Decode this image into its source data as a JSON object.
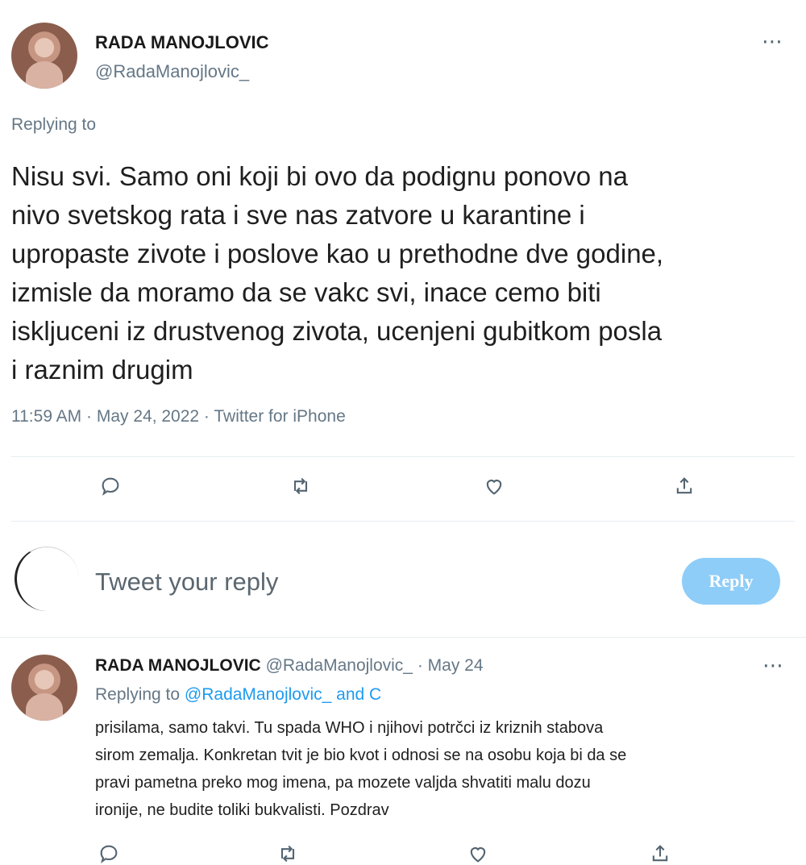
{
  "tweet": {
    "author_name": "RADA MANOJLOVIC",
    "author_handle": "@RadaManojlovic_",
    "replying_to_label": "Replying to",
    "text_lines": [
      "Nisu svi. Samo oni koji bi ovo da podignu ponovo na",
      "nivo svetskog rata i sve nas zatvore u karantine i",
      "upropaste zivote i poslove kao u prethodne dve godine,",
      "izmisle da moramo da se vakc svi, inace cemo biti",
      "iskljuceni iz drustvenog zivota, ucenjeni gubitkom posla",
      "i raznim drugim"
    ],
    "meta": "11:59 AM · May 24, 2022 · Twitter for iPhone",
    "more_icon": "⋯",
    "actions": [
      "reply-icon",
      "retweet-icon",
      "like-icon",
      "share-icon"
    ]
  },
  "reply_box": {
    "placeholder": "Tweet your reply",
    "button_label": "Reply",
    "button_color": "#8ecdf8"
  },
  "reply_tweet": {
    "author_name": "RADA MANOJLOVIC",
    "author_handle": "@RadaManojlovic_",
    "date": "· May 24",
    "replying_to_label": "Replying to",
    "replying_to_handle": "@RadaManojlovic_",
    "replying_to_and": "and C",
    "text_lines": [
      "prisilama, samo takvi. Tu spada WHO i njihovi potrčci iz kriznih stabova",
      "sirom zemalja. Konkretan tvit je bio kvot i odnosi se na osobu koja bi da se",
      "pravi pametna preko mog imena, pa mozete valjda shvatiti malu dozu",
      "ironije, ne budite toliki bukvalisti. Pozdrav"
    ],
    "more_icon": "⋯"
  },
  "colors": {
    "link": "#1d9bf0",
    "secondary_text": "#657786",
    "divider": "#e6ecf0"
  }
}
